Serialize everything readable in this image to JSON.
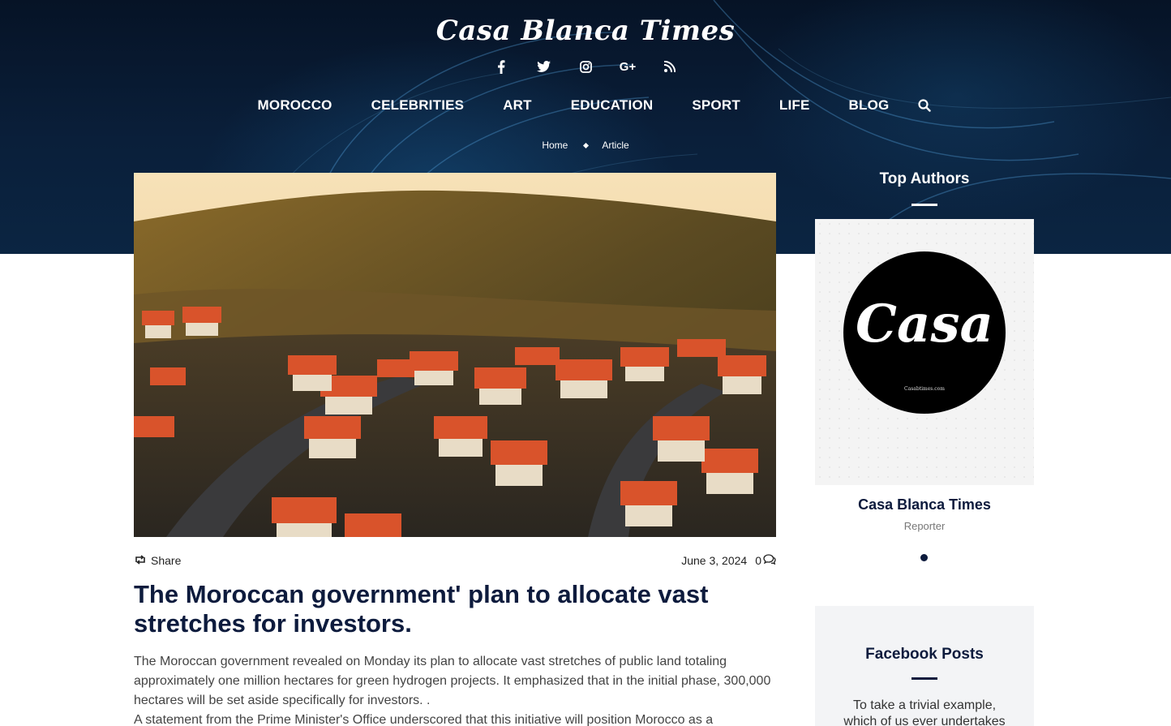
{
  "site": {
    "logo_text": "Casa Blanca Times"
  },
  "social": [
    {
      "name": "facebook-icon",
      "glyph": "f"
    },
    {
      "name": "twitter-icon",
      "glyph": "🐦"
    },
    {
      "name": "instagram-icon",
      "glyph": "◎"
    },
    {
      "name": "google-plus-icon",
      "glyph": "G+"
    },
    {
      "name": "rss-icon",
      "glyph": "⌇"
    }
  ],
  "nav": {
    "items": [
      "MOROCCO",
      "CELEBRITIES",
      "ART",
      "EDUCATION",
      "SPORT",
      "LIFE",
      "BLOG"
    ],
    "search_icon": "search-icon"
  },
  "breadcrumb": {
    "home": "Home",
    "current": "Article"
  },
  "article": {
    "share_label": "Share",
    "date": "June 3, 2024",
    "comment_count": "0",
    "title": "The Moroccan government' plan to allocate vast stretches for investors.",
    "paragraphs": [
      "The Moroccan government revealed on Monday its plan to allocate vast stretches of public land totaling approximately one million hectares for green hydrogen projects. It emphasized that in the initial phase, 300,000 hectares will be set aside specifically for investors. .",
      "A statement from the Prime Minister's Office underscored that this initiative will position Morocco as a"
    ]
  },
  "sidebar": {
    "top_authors_title": "Top Authors",
    "author": {
      "avatar_word": "Casa",
      "avatar_site": "Casabtimes.com",
      "name": "Casa Blanca Times",
      "role": "Reporter"
    },
    "facebook_title": "Facebook Posts",
    "facebook_text": "To take a trivial example, which of us ever undertakes"
  },
  "colors": {
    "navy": "#0d1b3d",
    "hero_bg": "#0a1f3a"
  }
}
